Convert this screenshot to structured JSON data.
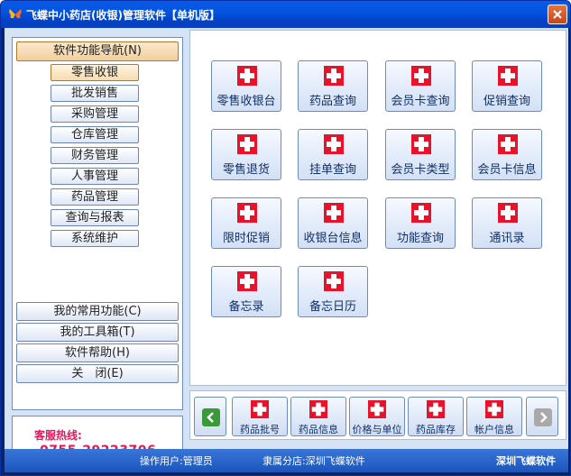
{
  "window": {
    "title": "飞蝶中小药店(收银)管理软件【单机版】"
  },
  "nav": {
    "header": "软件功能导航(N)",
    "items": [
      "零售收银",
      "批发销售",
      "采购管理",
      "仓库管理",
      "财务管理",
      "人事管理",
      "药品管理",
      "查询与报表",
      "系统维护"
    ],
    "bottom": [
      "我的常用功能(C)",
      "我的工具箱(T)",
      "软件帮助(H)",
      "关　闭(E)"
    ]
  },
  "hotline": {
    "label": "客服热线:",
    "number": "0755-29223706"
  },
  "tiles": [
    "零售收银台",
    "药品查询",
    "会员卡查询",
    "促销查询",
    "零售退货",
    "挂单查询",
    "会员卡类型",
    "会员卡信息",
    "限时促销",
    "收银台信息",
    "功能查询",
    "通讯录",
    "备忘录",
    "备忘日历"
  ],
  "toolbar": {
    "buttons": [
      "药品批号",
      "药品信息",
      "价格与单位",
      "药品库存",
      "帐户信息"
    ]
  },
  "status": {
    "user": "操作用户:管理员",
    "shop": "隶属分店:深圳飞蝶软件",
    "brand": "深圳飞蝶软件"
  },
  "colors": {
    "accent_red": "#e8132b",
    "title_blue": "#0454e0",
    "client_bg": "#d6e3f7",
    "hotline_pink": "#e2175a"
  },
  "icons": {
    "tile": "red-cross-icon",
    "left_arrow": "green-left-arrow-icon",
    "right_arrow": "gray-right-arrow-icon"
  }
}
